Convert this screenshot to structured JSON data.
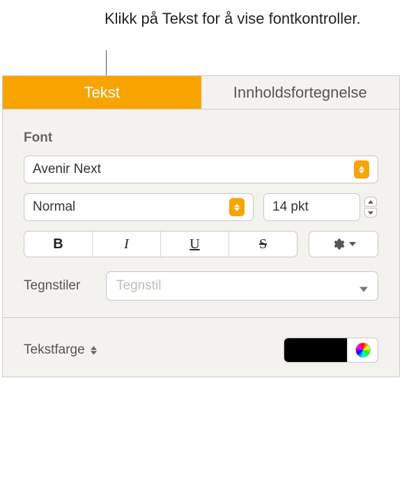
{
  "callout": "Klikk på Tekst for å vise fontkontroller.",
  "tabs": {
    "text": "Tekst",
    "toc": "Innholdsfortegnelse"
  },
  "font_section_label": "Font",
  "font_family": "Avenir Next",
  "font_style": "Normal",
  "font_size": "14 pkt",
  "char_styles_label": "Tegnstiler",
  "char_styles_placeholder": "Tegnstil",
  "text_color_label": "Tekstfarge",
  "style_buttons": {
    "bold": "B",
    "italic": "I",
    "underline": "U",
    "strike": "S"
  },
  "colors": {
    "current": "#000000"
  }
}
